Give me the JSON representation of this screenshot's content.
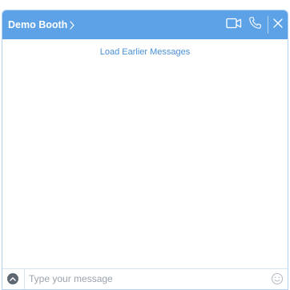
{
  "header": {
    "title": "Demo Booth",
    "icons": {
      "expand": "chevron-right-icon",
      "video": "video-camera-icon",
      "phone": "phone-icon",
      "close": "close-icon"
    }
  },
  "messages": {
    "load_earlier_label": "Load Earlier Messages"
  },
  "composer": {
    "placeholder": "Type your message",
    "value": "",
    "icons": {
      "attach": "chevron-up-icon",
      "emoji": "emoji-smile-icon"
    }
  },
  "colors": {
    "header_bg": "#5da2e6",
    "link": "#4a90d9",
    "border": "#b3d3f5"
  }
}
